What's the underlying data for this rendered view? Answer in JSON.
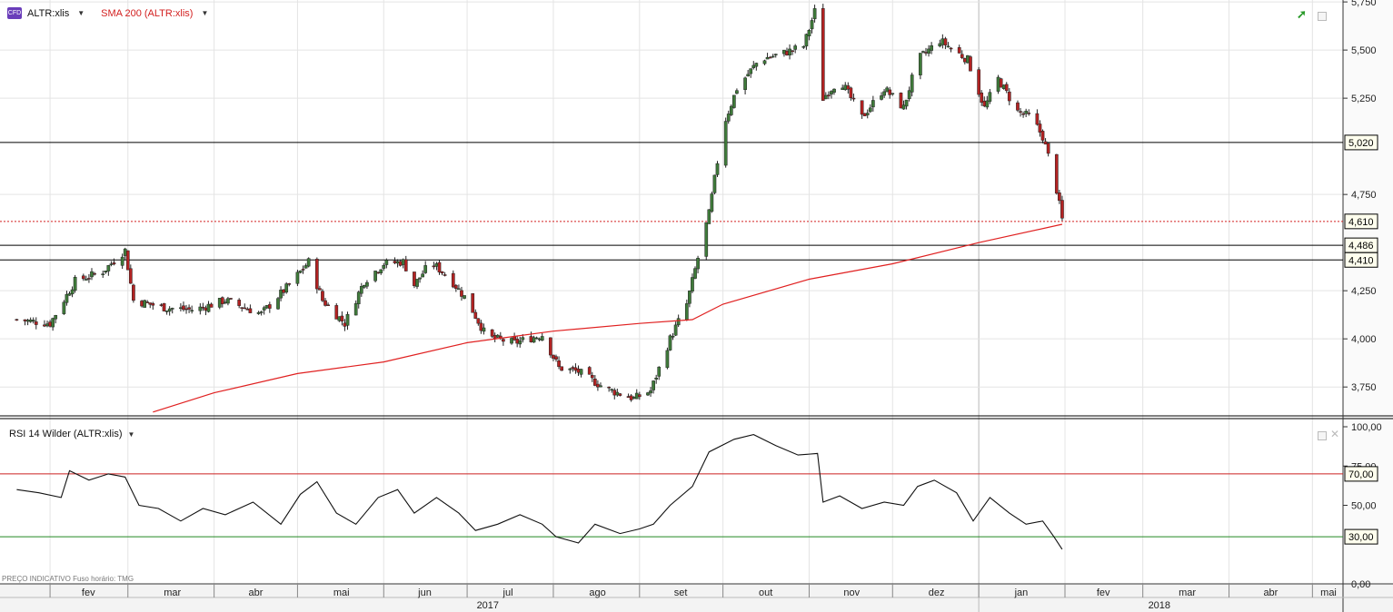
{
  "main_legend": {
    "symbol": "ALTR:xlis",
    "sma_label": "SMA 200 (ALTR:xlis)",
    "cfd_badge": "CFD"
  },
  "rsi_legend": {
    "label": "RSI 14 Wilder (ALTR:xlis)"
  },
  "footer_note": "PREÇO INDICATIVO   Fuso horário: TMG",
  "colors": {
    "up_candle": "#3f7a3a",
    "down_candle": "#b32222",
    "sma": "#e02020",
    "rsi_line": "#111111",
    "rsi_upper_band": "#cc2222",
    "rsi_lower_band": "#228822",
    "grid": "#e4e4e4",
    "axis": "#333333"
  },
  "icons": {
    "trend_icon": "trending-up-icon"
  },
  "chart_data": [
    {
      "type": "candlestick",
      "title": "",
      "ylim": [
        3600,
        5760
      ],
      "y_ticks": [
        "5,750",
        "5,500",
        "5,250",
        "4,750",
        "4,250",
        "4,000",
        "3,750"
      ],
      "y_tick_values": [
        5750,
        5500,
        5250,
        4750,
        4250,
        4000,
        3750
      ],
      "x_ticks": [
        "fev",
        "mar",
        "abr",
        "mai",
        "jun",
        "jul",
        "ago",
        "set",
        "out",
        "nov",
        "dez",
        "jan",
        "fev",
        "mar",
        "abr",
        "mai"
      ],
      "x_years": [
        "2017",
        "2018"
      ],
      "horizontal_lines": [
        {
          "value": 5020,
          "label": "5,020",
          "style": "solid",
          "color": "#000000"
        },
        {
          "value": 4610,
          "label": "4,610",
          "style": "dotted",
          "color": "#d32020"
        },
        {
          "value": 4486,
          "label": "4,486",
          "style": "solid",
          "color": "#000000"
        },
        {
          "value": 4410,
          "label": "4,410",
          "style": "solid",
          "color": "#000000"
        }
      ],
      "close_path": [
        [
          "2017-01-20",
          4100
        ],
        [
          "2017-02-01",
          4080
        ],
        [
          "2017-02-10",
          4300
        ],
        [
          "2017-02-20",
          4350
        ],
        [
          "2017-02-28",
          4460
        ],
        [
          "2017-03-03",
          4200
        ],
        [
          "2017-03-15",
          4160
        ],
        [
          "2017-03-25",
          4150
        ],
        [
          "2017-04-05",
          4200
        ],
        [
          "2017-04-18",
          4130
        ],
        [
          "2017-04-28",
          4280
        ],
        [
          "2017-05-05",
          4400
        ],
        [
          "2017-05-10",
          4200
        ],
        [
          "2017-05-18",
          4080
        ],
        [
          "2017-05-25",
          4300
        ],
        [
          "2017-06-01",
          4390
        ],
        [
          "2017-06-08",
          4400
        ],
        [
          "2017-06-12",
          4280
        ],
        [
          "2017-06-18",
          4400
        ],
        [
          "2017-06-25",
          4310
        ],
        [
          "2017-07-01",
          4200
        ],
        [
          "2017-07-08",
          4010
        ],
        [
          "2017-07-18",
          3980
        ],
        [
          "2017-07-28",
          4020
        ],
        [
          "2017-08-03",
          3850
        ],
        [
          "2017-08-10",
          3830
        ],
        [
          "2017-08-20",
          3740
        ],
        [
          "2017-08-30",
          3690
        ],
        [
          "2017-09-05",
          3730
        ],
        [
          "2017-09-12",
          4000
        ],
        [
          "2017-09-18",
          4180
        ],
        [
          "2017-09-23",
          4480
        ],
        [
          "2017-09-26",
          4650
        ],
        [
          "2017-10-01",
          5100
        ],
        [
          "2017-10-06",
          5300
        ],
        [
          "2017-10-14",
          5450
        ],
        [
          "2017-10-22",
          5480
        ],
        [
          "2017-10-30",
          5520
        ],
        [
          "2017-11-03",
          5700
        ],
        [
          "2017-11-06",
          5250
        ],
        [
          "2017-11-12",
          5350
        ],
        [
          "2017-11-20",
          5150
        ],
        [
          "2017-11-28",
          5300
        ],
        [
          "2017-12-05",
          5200
        ],
        [
          "2017-12-10",
          5450
        ],
        [
          "2017-12-18",
          5550
        ],
        [
          "2017-12-28",
          5450
        ],
        [
          "2018-01-03",
          5200
        ],
        [
          "2018-01-08",
          5350
        ],
        [
          "2018-01-15",
          5180
        ],
        [
          "2018-01-20",
          5150
        ],
        [
          "2018-01-24",
          5050
        ],
        [
          "2018-01-28",
          4850
        ],
        [
          "2018-01-31",
          4620
        ]
      ],
      "overlay": {
        "name": "SMA 200 (ALTR:xlis)",
        "points": [
          [
            "2017-03-10",
            3620
          ],
          [
            "2017-04-01",
            3720
          ],
          [
            "2017-05-01",
            3820
          ],
          [
            "2017-06-01",
            3880
          ],
          [
            "2017-07-01",
            3980
          ],
          [
            "2017-08-01",
            4040
          ],
          [
            "2017-09-01",
            4080
          ],
          [
            "2017-09-20",
            4100
          ],
          [
            "2017-10-01",
            4180
          ],
          [
            "2017-11-01",
            4310
          ],
          [
            "2017-12-01",
            4390
          ],
          [
            "2018-01-01",
            4500
          ],
          [
            "2018-01-31",
            4595
          ]
        ]
      }
    },
    {
      "type": "line",
      "title": "RSI 14 Wilder (ALTR:xlis)",
      "ylim": [
        0,
        100
      ],
      "y_ticks": [
        "100,00",
        "75,00",
        "50,00",
        "0,00"
      ],
      "y_tick_values": [
        100,
        75,
        50,
        0
      ],
      "bands": [
        {
          "value": 70,
          "label": "70,00",
          "color": "#cc2222"
        },
        {
          "value": 30,
          "label": "30,00",
          "color": "#228822"
        }
      ],
      "series": [
        {
          "points": [
            [
              "2017-01-20",
              60
            ],
            [
              "2017-01-28",
              58
            ],
            [
              "2017-02-05",
              55
            ],
            [
              "2017-02-08",
              72
            ],
            [
              "2017-02-15",
              66
            ],
            [
              "2017-02-22",
              70
            ],
            [
              "2017-02-28",
              68
            ],
            [
              "2017-03-05",
              50
            ],
            [
              "2017-03-12",
              48
            ],
            [
              "2017-03-20",
              40
            ],
            [
              "2017-03-28",
              48
            ],
            [
              "2017-04-05",
              44
            ],
            [
              "2017-04-15",
              52
            ],
            [
              "2017-04-25",
              38
            ],
            [
              "2017-05-02",
              57
            ],
            [
              "2017-05-08",
              65
            ],
            [
              "2017-05-15",
              45
            ],
            [
              "2017-05-22",
              38
            ],
            [
              "2017-05-30",
              55
            ],
            [
              "2017-06-06",
              60
            ],
            [
              "2017-06-12",
              45
            ],
            [
              "2017-06-20",
              55
            ],
            [
              "2017-06-28",
              45
            ],
            [
              "2017-07-04",
              34
            ],
            [
              "2017-07-12",
              38
            ],
            [
              "2017-07-20",
              44
            ],
            [
              "2017-07-28",
              38
            ],
            [
              "2017-08-02",
              30
            ],
            [
              "2017-08-10",
              26
            ],
            [
              "2017-08-16",
              38
            ],
            [
              "2017-08-25",
              32
            ],
            [
              "2017-09-01",
              35
            ],
            [
              "2017-09-06",
              38
            ],
            [
              "2017-09-12",
              50
            ],
            [
              "2017-09-20",
              62
            ],
            [
              "2017-09-26",
              84
            ],
            [
              "2017-10-05",
              92
            ],
            [
              "2017-10-12",
              95
            ],
            [
              "2017-10-20",
              88
            ],
            [
              "2017-10-28",
              82
            ],
            [
              "2017-11-04",
              83
            ],
            [
              "2017-11-06",
              52
            ],
            [
              "2017-11-12",
              56
            ],
            [
              "2017-11-20",
              48
            ],
            [
              "2017-11-28",
              52
            ],
            [
              "2017-12-05",
              50
            ],
            [
              "2017-12-10",
              62
            ],
            [
              "2017-12-16",
              66
            ],
            [
              "2017-12-24",
              58
            ],
            [
              "2017-12-30",
              40
            ],
            [
              "2018-01-05",
              55
            ],
            [
              "2018-01-12",
              45
            ],
            [
              "2018-01-18",
              38
            ],
            [
              "2018-01-24",
              40
            ],
            [
              "2018-01-28",
              30
            ],
            [
              "2018-01-31",
              22
            ]
          ]
        }
      ]
    }
  ]
}
